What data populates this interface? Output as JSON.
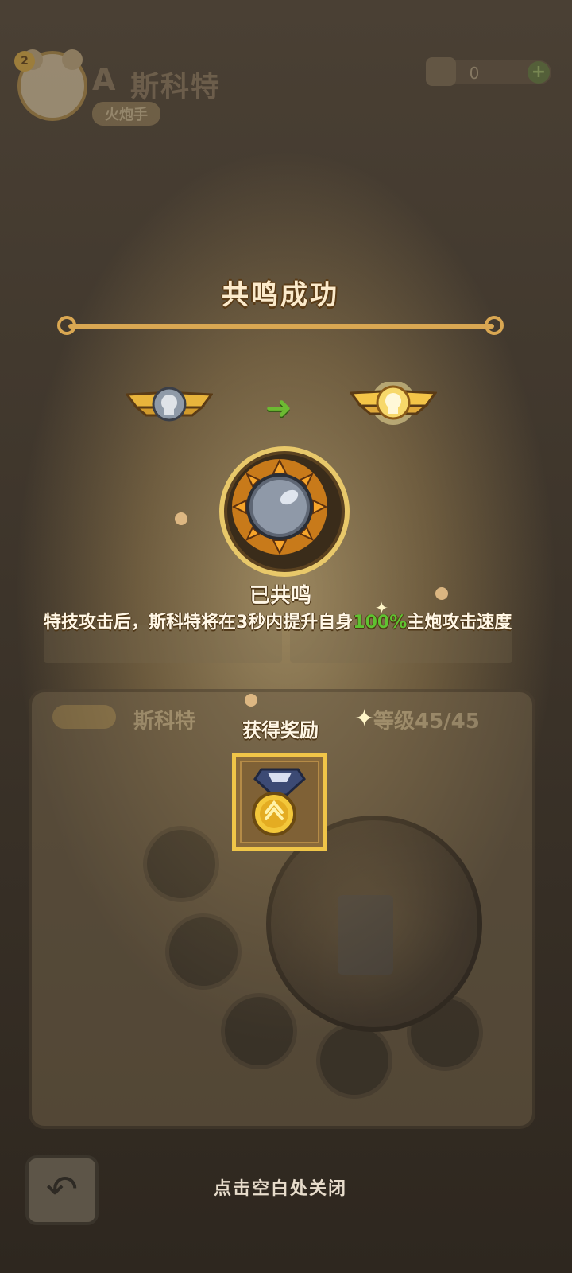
{
  "header": {
    "level_badge": "2",
    "hero_grade": "A",
    "hero_name": "斯科特",
    "hero_role": "火炮手",
    "currency_value": "0",
    "currency_plus": "+"
  },
  "hero_panel": {
    "name": "斯科特",
    "level": "等级45/45"
  },
  "popup": {
    "title": "共鸣成功",
    "status": "已共鸣",
    "description_before": "特技攻击后，斯科特将在3秒内提升自身",
    "description_highlight": "100%",
    "description_after": "主炮攻击速度",
    "reward_label": "获得奖励",
    "close_hint": "点击空白处关闭"
  },
  "colors": {
    "highlight_green": "#5fc231",
    "gold": "#f0c548",
    "arrow_green": "#6cba32"
  },
  "icons": {
    "back": "back-arrow-icon",
    "from_emblem": "winged-badge-icon",
    "to_emblem": "glowing-winged-badge-icon",
    "skill": "cannonball-sun-icon",
    "reward": "gold-medal-icon"
  }
}
